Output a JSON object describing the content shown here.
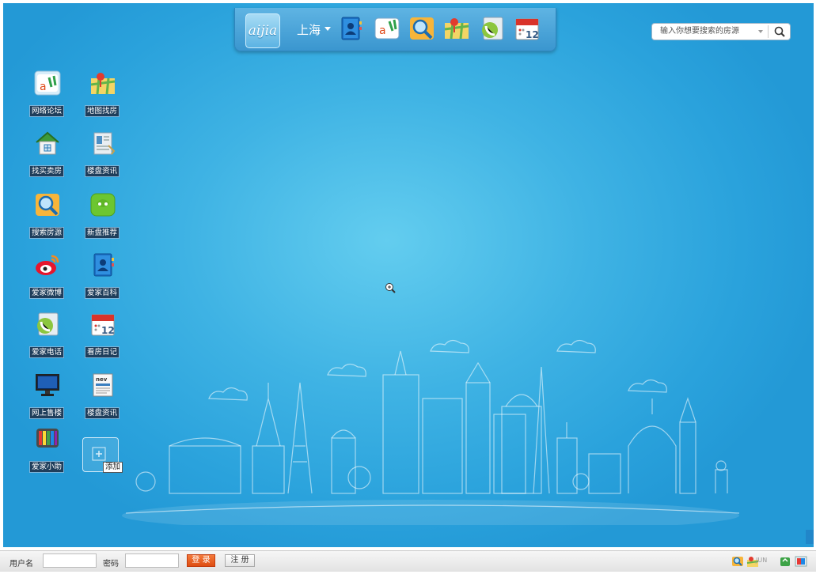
{
  "dock": {
    "logo_text": "aijia",
    "city": "上海",
    "icons": [
      "contacts-book-icon",
      "forum-icon",
      "search-house-icon",
      "map-icon",
      "phone-icon",
      "calendar-icon"
    ],
    "calendar_day": "12"
  },
  "search": {
    "placeholder": "输入你想要搜索的房源"
  },
  "desktop_icons": [
    {
      "label": "网络论坛",
      "icon": "forum-icon"
    },
    {
      "label": "地图找房",
      "icon": "map-icon"
    },
    {
      "label": "找买卖房",
      "icon": "house-icon"
    },
    {
      "label": "楼盘资讯",
      "icon": "building-info-icon"
    },
    {
      "label": "搜索房源",
      "icon": "search-house-icon"
    },
    {
      "label": "新盘推荐",
      "icon": "chat-bubble-icon"
    },
    {
      "label": "爱家微博",
      "icon": "weibo-icon"
    },
    {
      "label": "爱家百科",
      "icon": "contacts-book-icon"
    },
    {
      "label": "爱家电话",
      "icon": "phone-icon"
    },
    {
      "label": "看房日记",
      "icon": "calendar-icon"
    },
    {
      "label": "网上售楼",
      "icon": "monitor-icon"
    },
    {
      "label": "楼盘资讯",
      "icon": "news-icon"
    },
    {
      "label": "爱家小助",
      "icon": "color-bars-icon"
    }
  ],
  "add_tile": {
    "tooltip": "添加"
  },
  "taskbar": {
    "username_label": "用户名",
    "username_value": "",
    "password_label": "密码",
    "password_value": "",
    "login_label": "登 录",
    "register_label": "注 册",
    "tray_text": "JUN"
  },
  "colors": {
    "desktop_blue": "#2aa2dc",
    "login_orange": "#de4d12"
  }
}
